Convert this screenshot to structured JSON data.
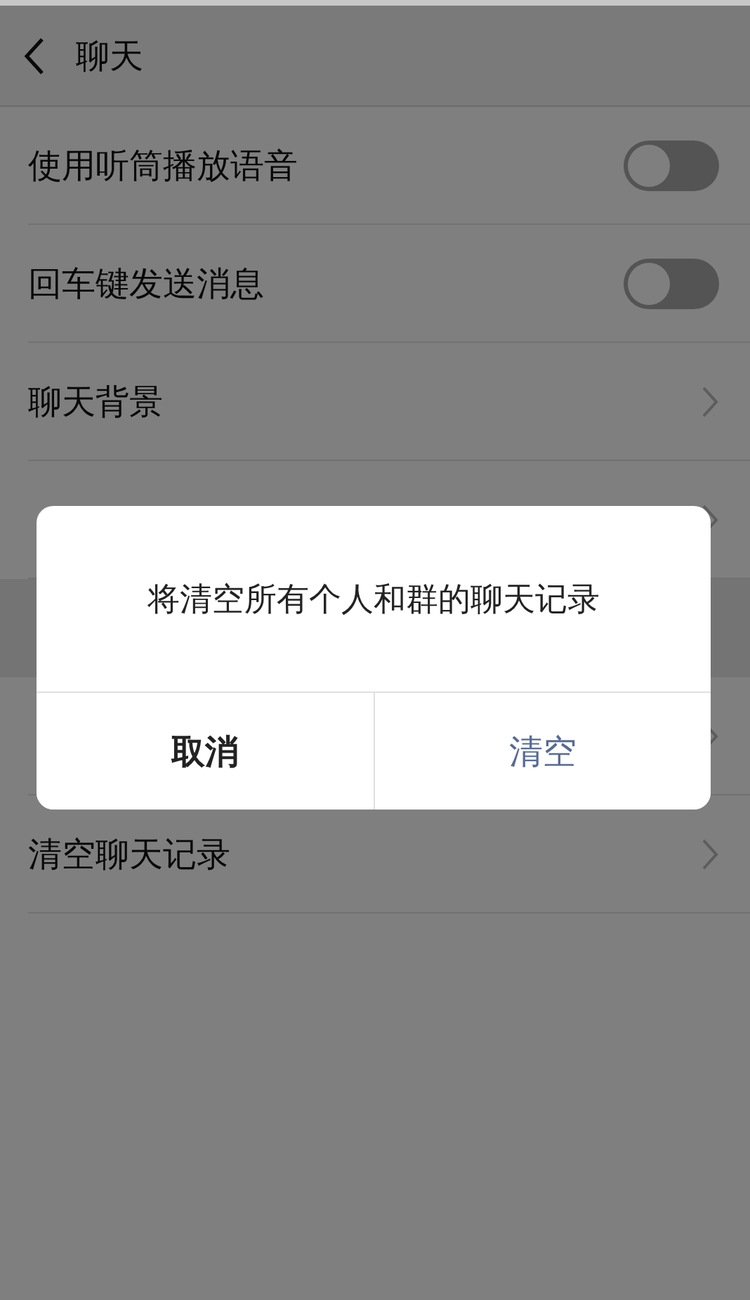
{
  "header": {
    "title": "聊天"
  },
  "rows": [
    {
      "kind": "toggle",
      "label": "使用听筒播放语音",
      "on": false
    },
    {
      "kind": "toggle",
      "label": "回车键发送消息",
      "on": false
    },
    {
      "kind": "link",
      "label": "聊天背景"
    },
    {
      "kind": "link"
    },
    {
      "kind": "section"
    },
    {
      "kind": "link"
    },
    {
      "kind": "link",
      "label": "清空聊天记录"
    }
  ],
  "dialog": {
    "message": "将清空所有个人和群的聊天记录",
    "buttons": [
      {
        "label": "取消",
        "kind": "cancel"
      },
      {
        "label": "清空",
        "kind": "confirm"
      }
    ]
  }
}
